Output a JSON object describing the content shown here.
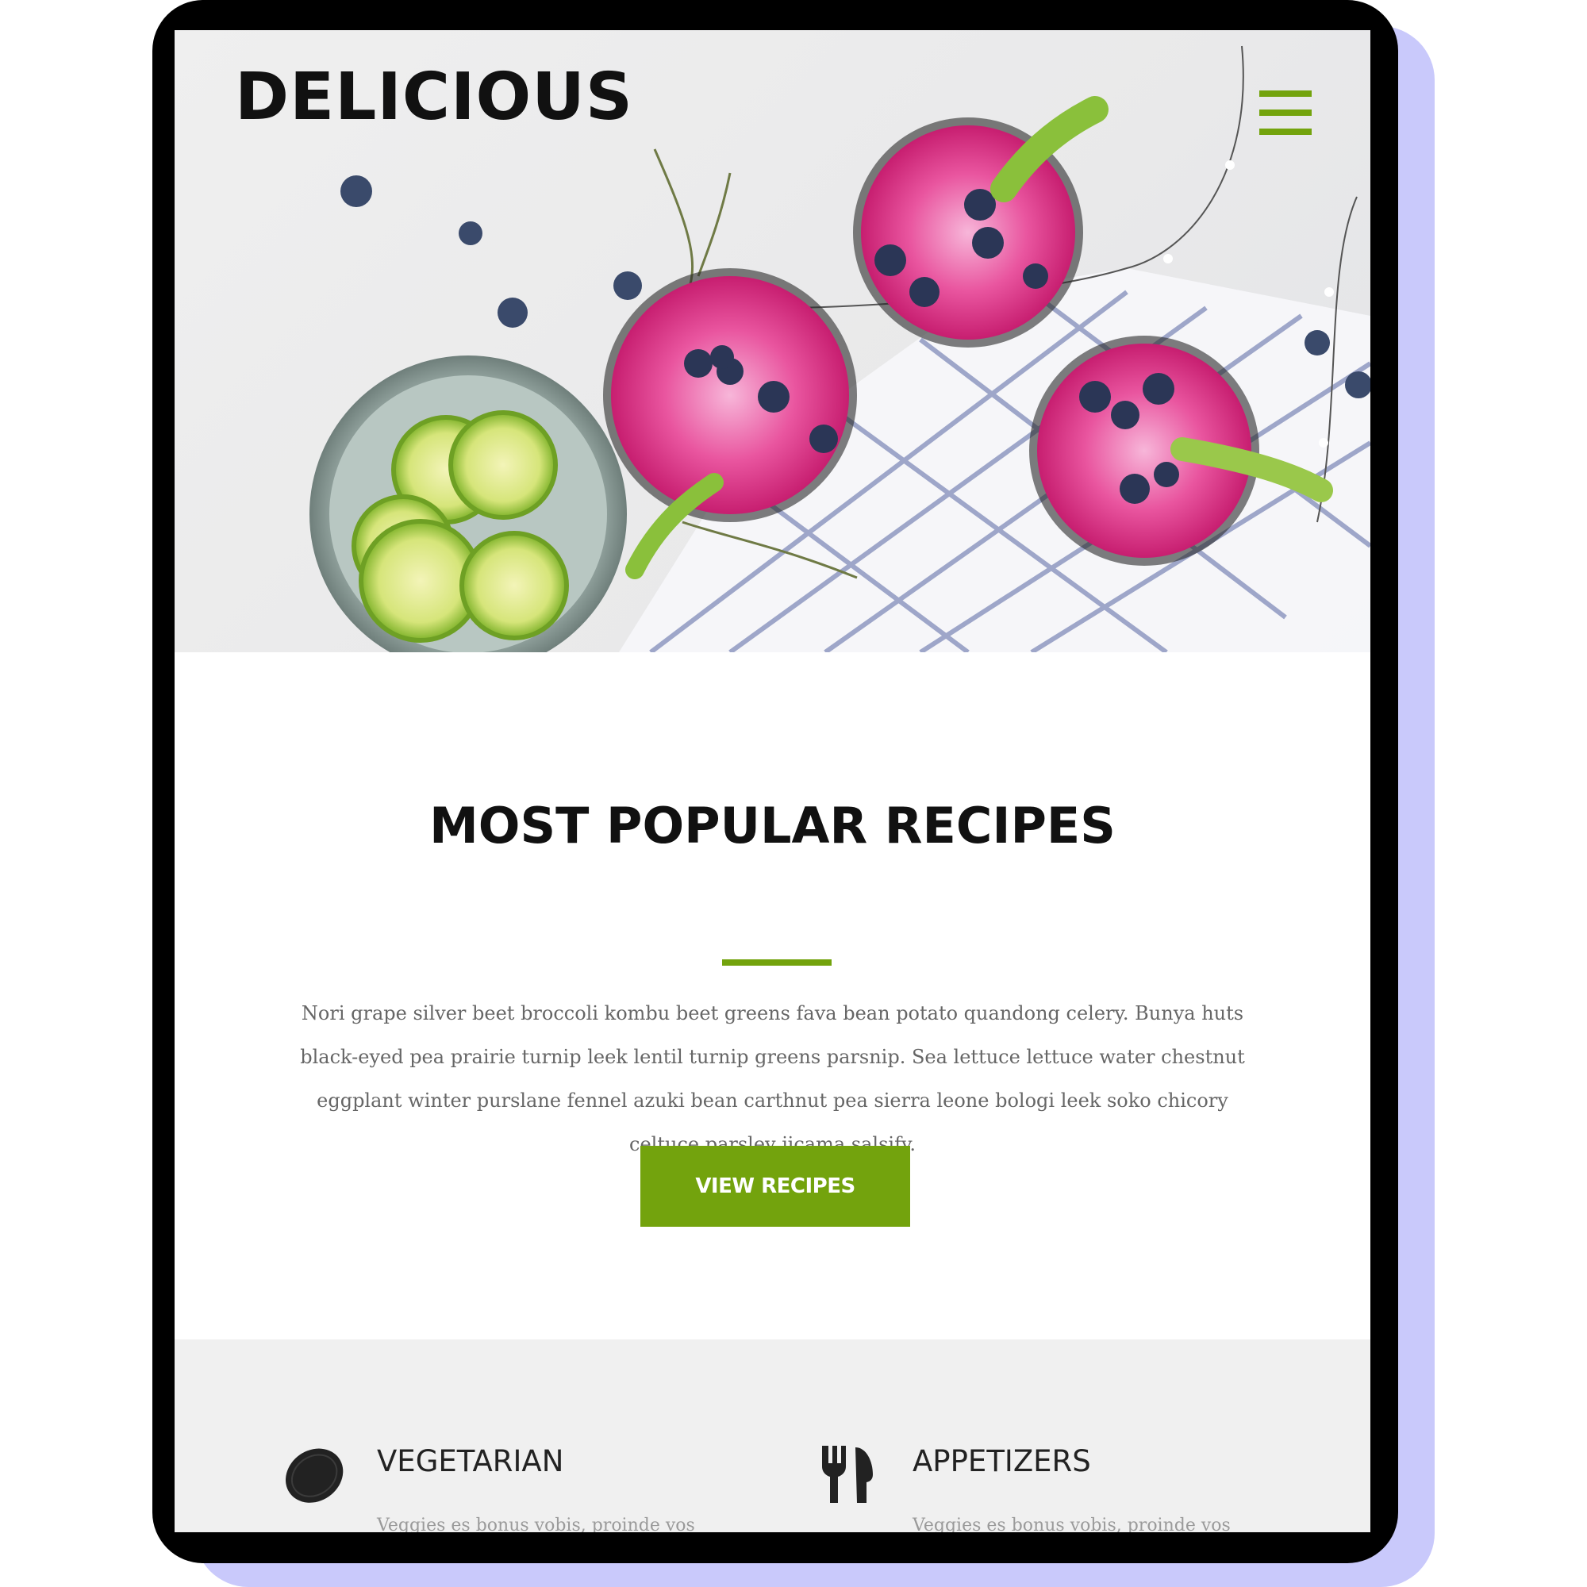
{
  "site": {
    "logo": "DELICIOUS",
    "menu_icon": "hamburger-menu-icon",
    "accent_color": "#73a30d"
  },
  "hero": {
    "image_subject": "pink berry drinks with limes and blueberries"
  },
  "popular": {
    "title": "MOST POPULAR RECIPES",
    "body": "Nori grape silver beet broccoli kombu beet greens fava bean potato quandong celery. Bunya huts black-eyed pea prairie turnip leek lentil turnip greens parsnip. Sea lettuce lettuce water chestnut eggplant winter purslane fennel azuki bean carthnut pea sierra leone bologi leek soko chicory celtuce parsley jicama salsify.",
    "cta_label": "VIEW RECIPES"
  },
  "categories": [
    {
      "title": "VEGETARIAN",
      "icon": "lemon-icon",
      "text": "Veggies es bonus vobis, proinde vos"
    },
    {
      "title": "APPETIZERS",
      "icon": "utensils-icon",
      "text": "Veggies es bonus vobis, proinde vos"
    }
  ]
}
